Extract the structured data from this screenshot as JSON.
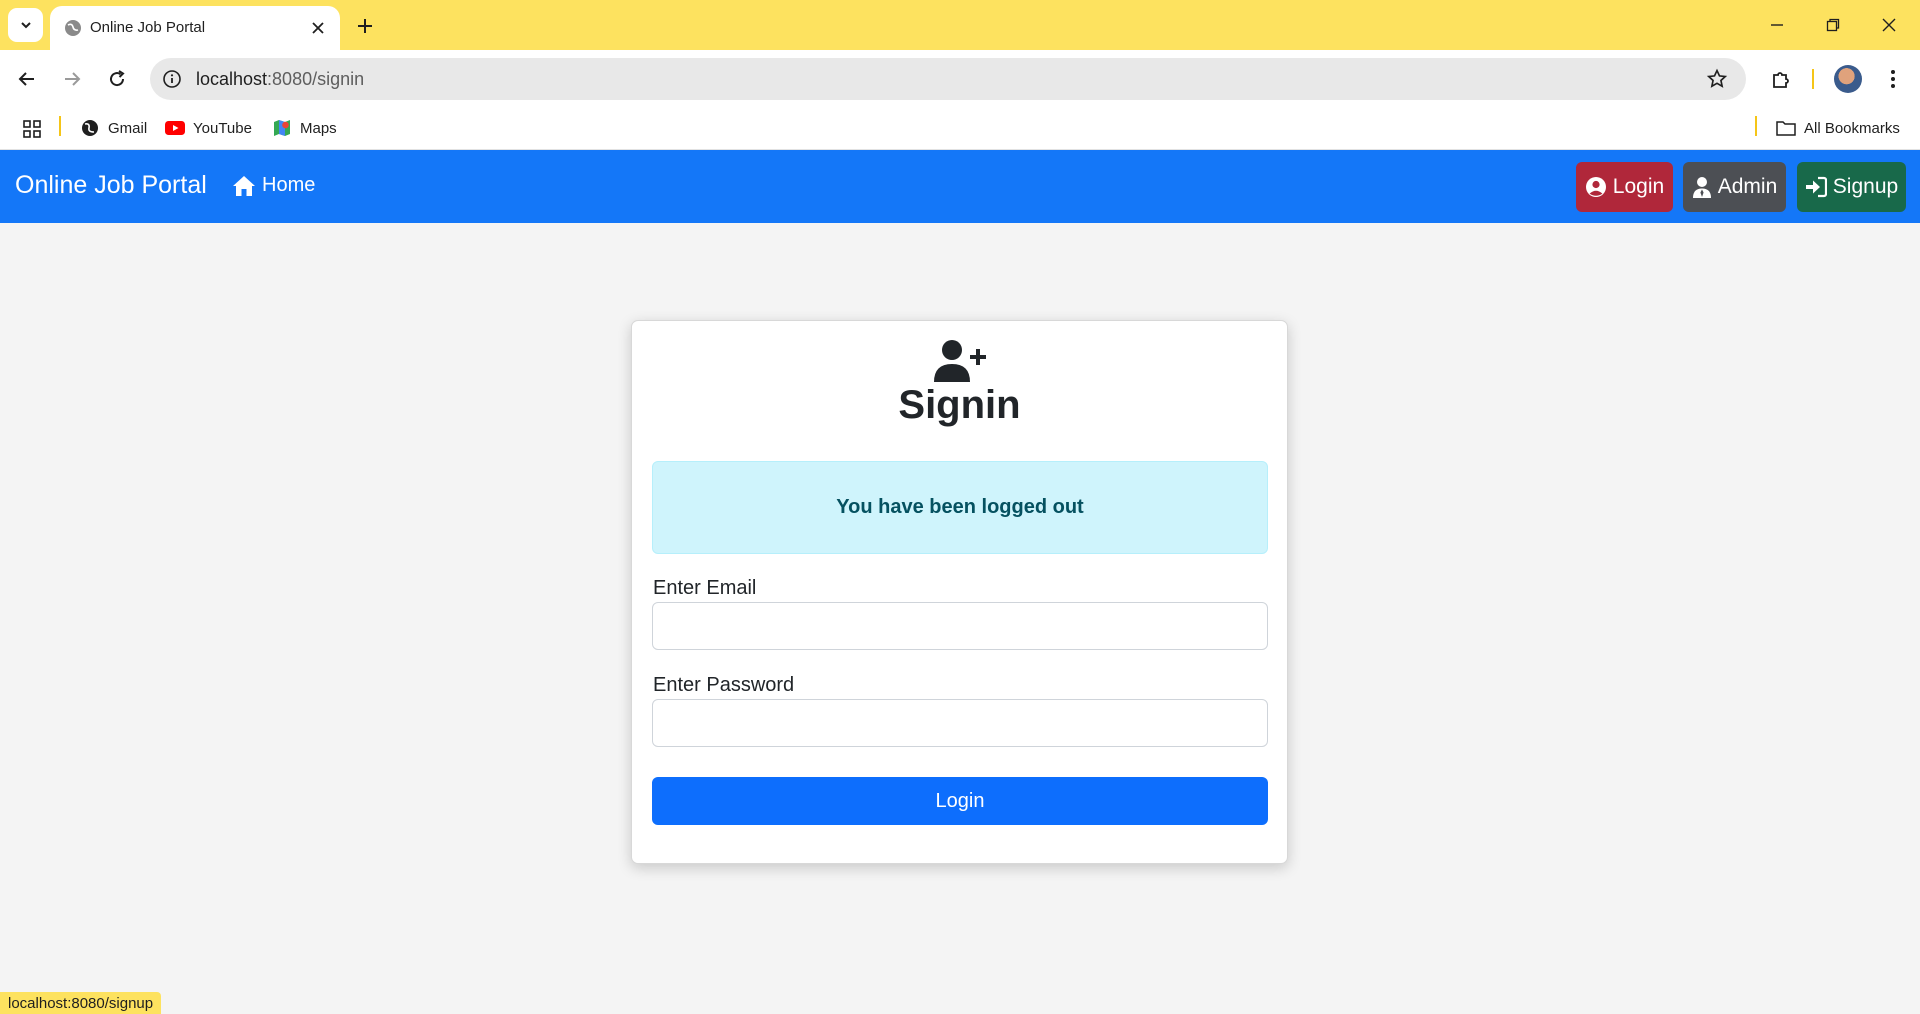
{
  "browser": {
    "tab_title": "Online Job Portal",
    "url_host": "localhost",
    "url_rest": ":8080/signin",
    "bookmarks": [
      {
        "label": "Gmail",
        "icon": "globe-icon"
      },
      {
        "label": "YouTube",
        "icon": "youtube-icon"
      },
      {
        "label": "Maps",
        "icon": "maps-icon"
      }
    ],
    "all_bookmarks_label": "All Bookmarks",
    "status_url": "localhost:8080/signup"
  },
  "navbar": {
    "brand": "Online Job Portal",
    "home_label": "Home",
    "login_label": "Login",
    "admin_label": "Admin",
    "signup_label": "Signup",
    "colors": {
      "bar": "#1477f8",
      "login": "#b0273a",
      "admin": "#4c4f54",
      "signup": "#18694a"
    }
  },
  "signin": {
    "title": "Signin",
    "alert_message": "You have been logged out",
    "email_label": "Enter Email",
    "email_value": "",
    "password_label": "Enter Password",
    "password_value": "",
    "submit_label": "Login"
  }
}
